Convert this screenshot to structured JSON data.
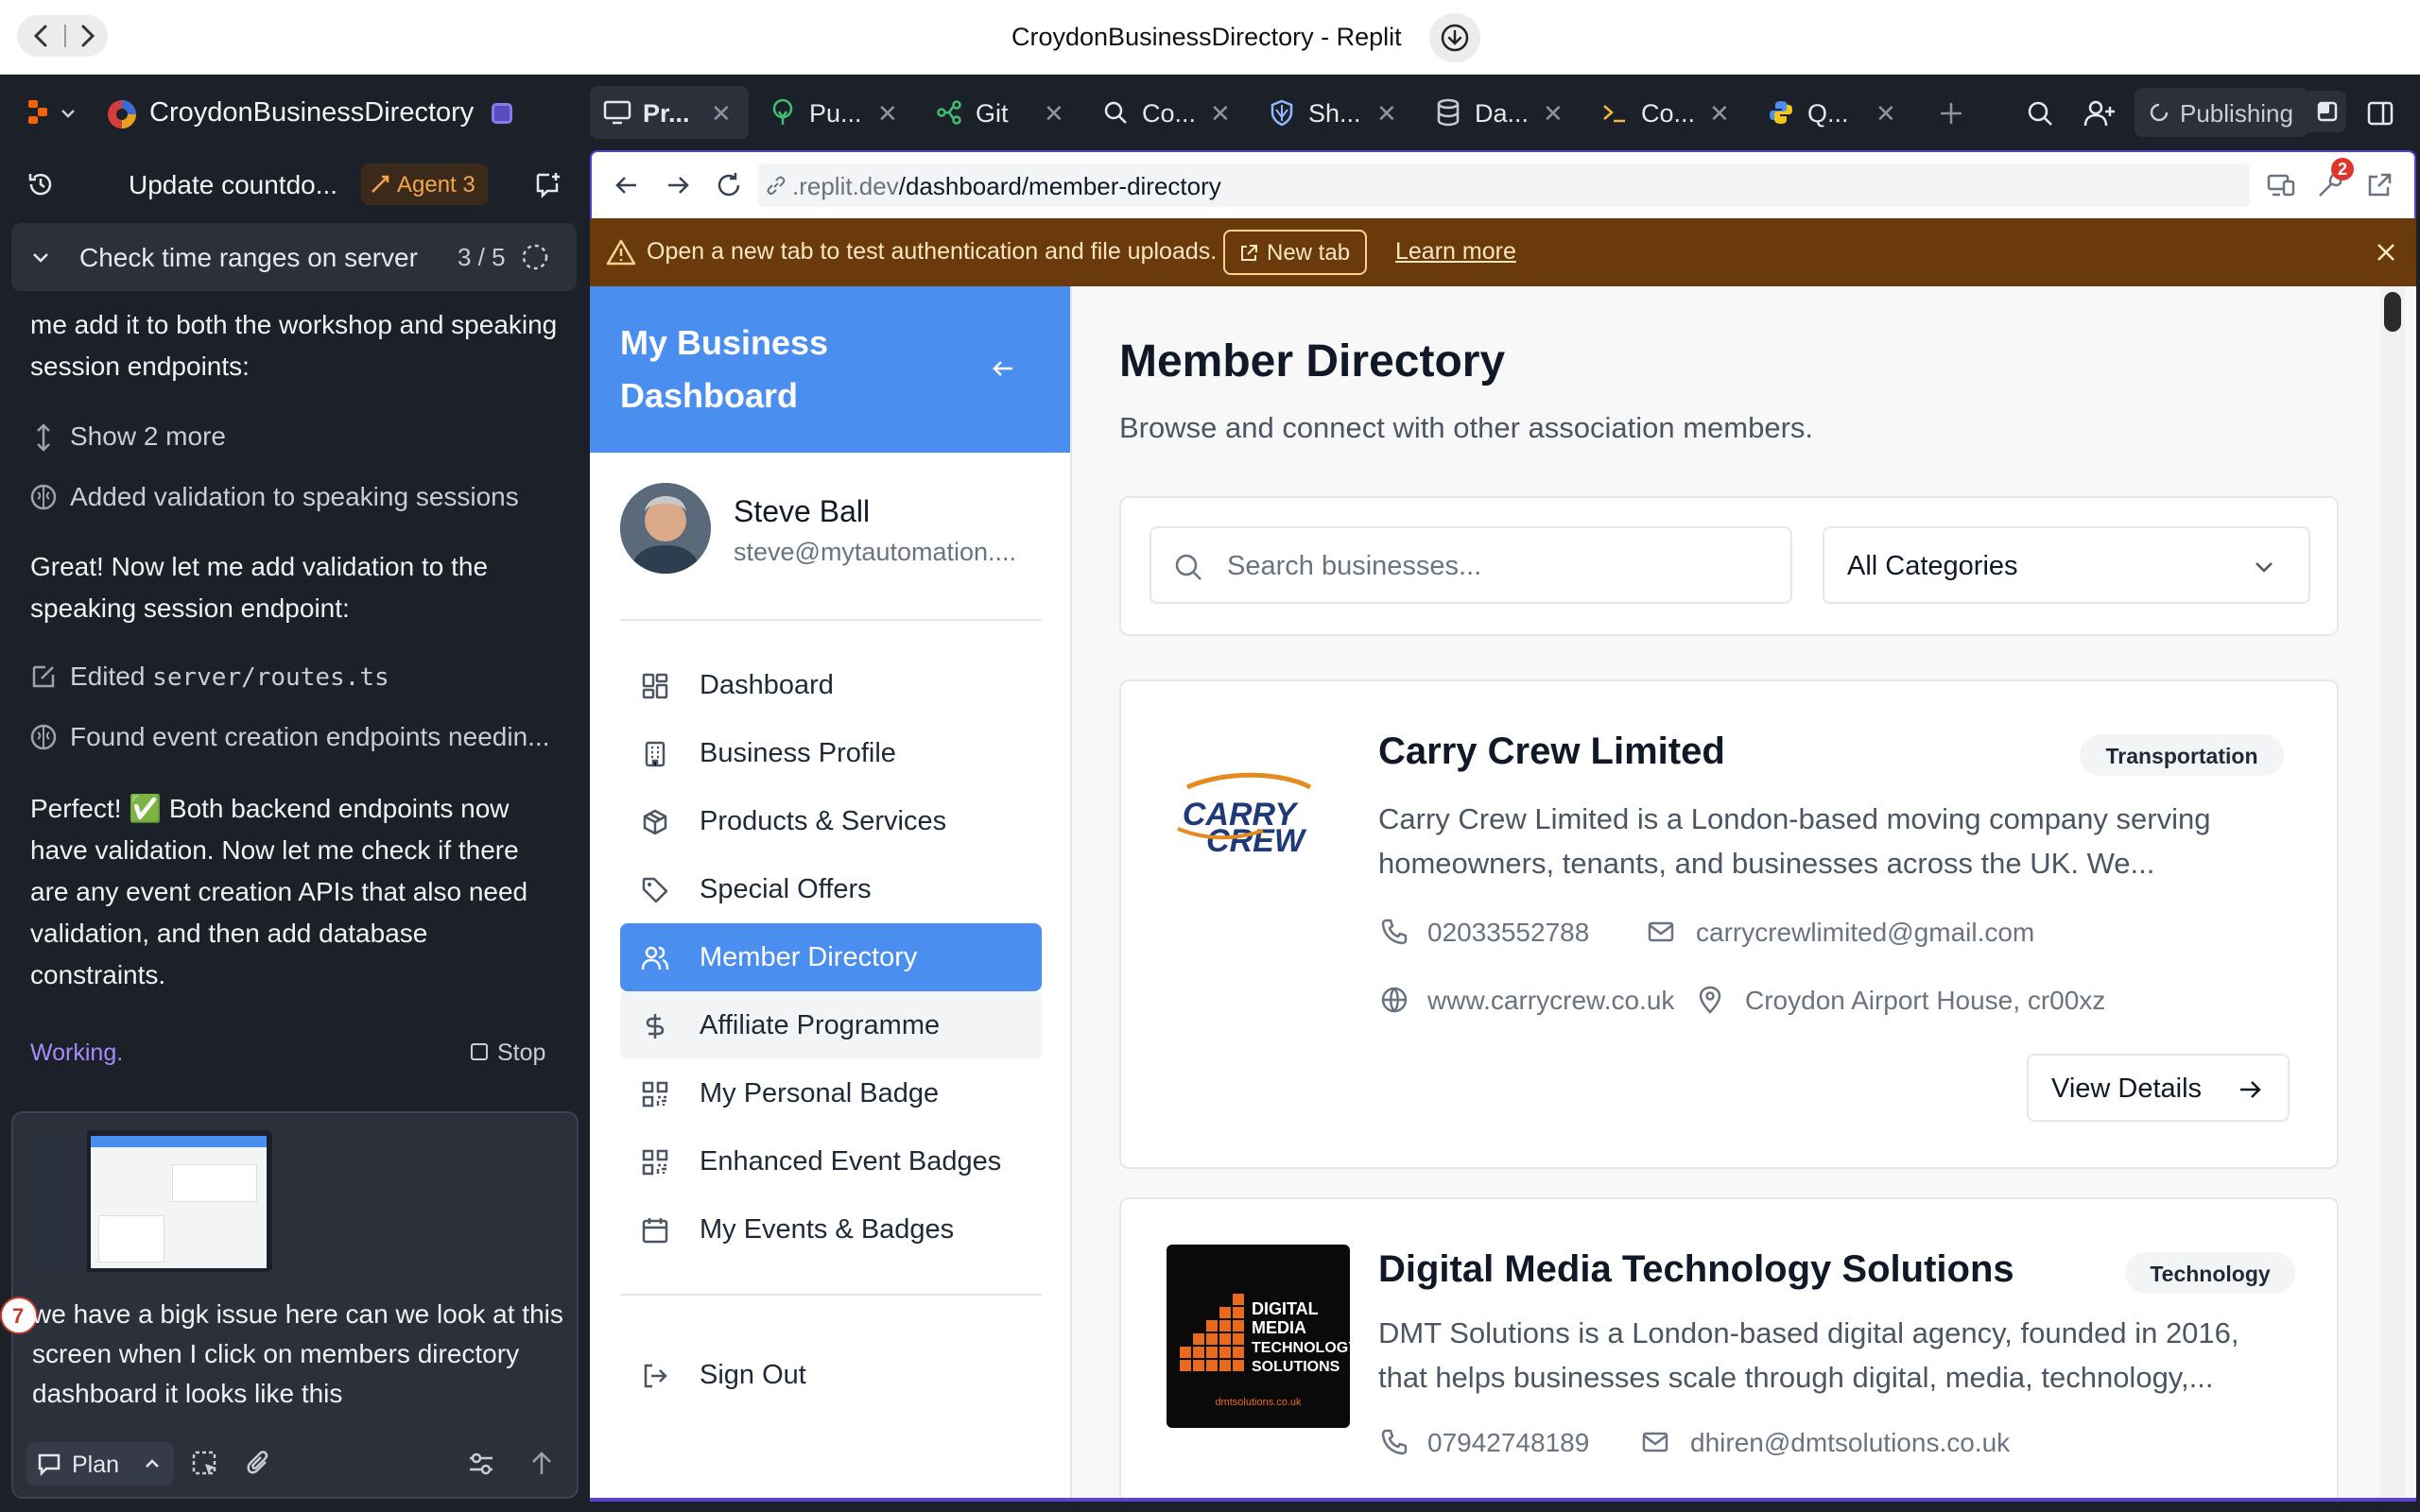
{
  "window": {
    "title": "CroydonBusinessDirectory - Replit"
  },
  "header": {
    "project_name": "CroydonBusinessDirectory",
    "tabs": [
      {
        "label": "Pr..."
      },
      {
        "label": "Pu..."
      },
      {
        "label": "Git"
      },
      {
        "label": "Co..."
      },
      {
        "label": "Sh..."
      },
      {
        "label": "Da..."
      },
      {
        "label": "Co..."
      },
      {
        "label": "Q..."
      }
    ],
    "publishing_label": "Publishing"
  },
  "agent": {
    "thread_title": "Update countdo...",
    "agent_badge": "Agent 3",
    "task_title": "Check time ranges on server",
    "task_progress": "3 / 5",
    "messages": {
      "m1": "me add it to both the workshop and speaking session endpoints:",
      "show_more": "Show 2 more",
      "action1": "Added validation to speaking sessions",
      "m2": "Great! Now let me add validation to the speaking session endpoint:",
      "action2_prefix": "Edited ",
      "action2_file": "server/routes.ts",
      "action3": "Found event creation endpoints needin...",
      "m3": "Perfect! ✅ Both backend endpoints now have validation. Now let me check if there are any event creation APIs that also need validation, and then add database constraints."
    },
    "status": "Working.",
    "stop_label": "Stop",
    "input": {
      "text": "we have a bigk issue here can we look at this screen when I click on members directory dashboard it looks like this",
      "badge_count": "7",
      "mode_label": "Plan"
    }
  },
  "preview": {
    "url_prefix": ".replit.dev",
    "url_path": "/dashboard/member-directory",
    "notification_count": "2",
    "banner": {
      "text": "Open a new tab to test authentication and file uploads.",
      "new_tab": "New tab",
      "learn_more": "Learn more"
    }
  },
  "site": {
    "sidebar": {
      "title": "My Business Dashboard",
      "user_name": "Steve Ball",
      "user_email": "steve@mytautomation....",
      "items": [
        {
          "label": "Dashboard",
          "icon": "grid-icon"
        },
        {
          "label": "Business Profile",
          "icon": "building-icon"
        },
        {
          "label": "Products & Services",
          "icon": "package-icon"
        },
        {
          "label": "Special Offers",
          "icon": "tag-icon"
        },
        {
          "label": "Member Directory",
          "icon": "users-icon"
        },
        {
          "label": "Affiliate Programme",
          "icon": "dollar-icon"
        },
        {
          "label": "My Personal Badge",
          "icon": "qr-icon"
        },
        {
          "label": "Enhanced Event Badges",
          "icon": "qr-icon"
        },
        {
          "label": "My Events & Badges",
          "icon": "calendar-icon"
        }
      ],
      "sign_out": "Sign Out"
    },
    "page_title": "Member Directory",
    "page_subtitle": "Browse and connect with other association members.",
    "search_placeholder": "Search businesses...",
    "category_select": "All Categories",
    "listings": [
      {
        "name": "Carry Crew Limited",
        "category": "Transportation",
        "description": "Carry Crew Limited is a London-based moving company serving homeowners, tenants, and businesses across the UK. We...",
        "phone": "02033552788",
        "email": "carrycrewlimited@gmail.com",
        "website": "www.carrycrew.co.uk",
        "address": "Croydon Airport House, cr00xz",
        "button": "View Details",
        "logo_text": [
          "CARRY",
          "CREW"
        ]
      },
      {
        "name": "Digital Media Technology Solutions",
        "category": "Technology",
        "description": "DMT Solutions is a London-based digital agency, founded in 2016, that helps businesses scale through digital, media, technology,...",
        "phone": "07942748189",
        "email": "dhiren@dmtsolutions.co.uk",
        "logo_text": [
          "DIGITAL",
          "MEDIA",
          "TECHNOLOGY",
          "SOLUTIONS",
          "dmtsolutions.co.uk"
        ]
      }
    ]
  },
  "colors": {
    "accent_blue": "#4a8ef0",
    "dark_bg": "#1c2029",
    "banner_bg": "#6b3a0b",
    "purple": "#5b3fd6"
  }
}
